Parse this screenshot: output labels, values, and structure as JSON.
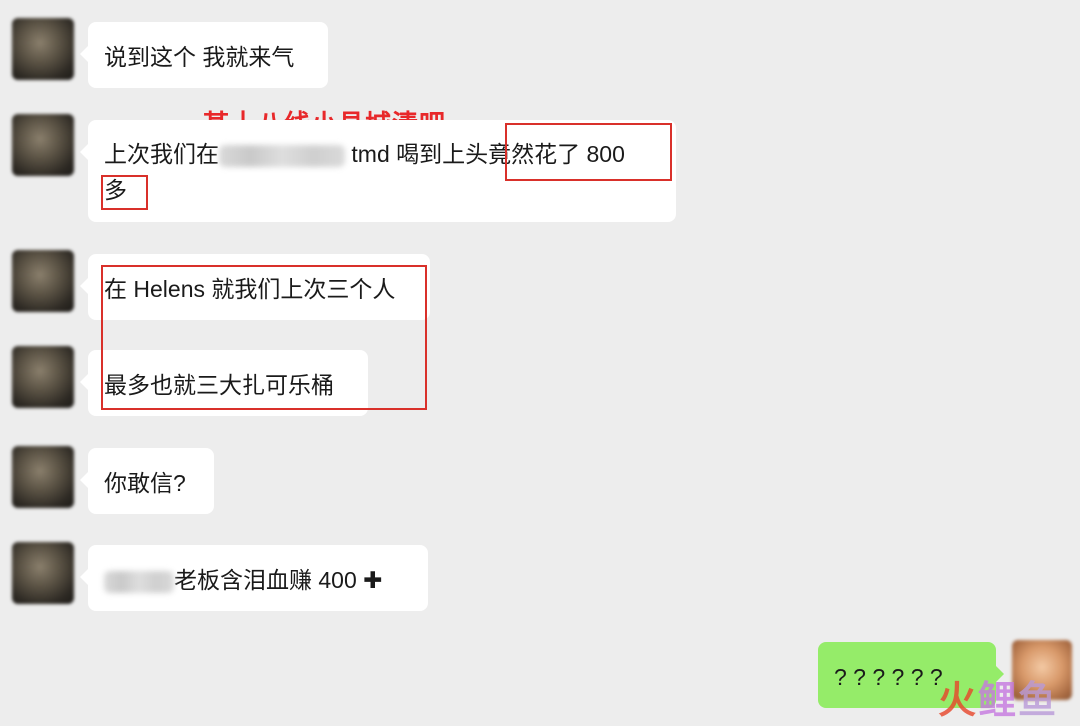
{
  "messages": [
    {
      "text": "说到这个 我就来气"
    },
    {
      "part1": "上次我们在",
      "part2": " tmd 喝到上头",
      "part3": "竟然花了 800",
      "line2": "多"
    },
    {
      "text": "在 Helens 就我们上次三个人"
    },
    {
      "text": "最多也就三大扎可乐桶"
    },
    {
      "text": "你敢信?"
    },
    {
      "text": "老板含泪血赚 400",
      "icon": "plus-icon",
      "icon_glyph": "✚"
    },
    {
      "text": "? ? ? ? ? ?"
    }
  ],
  "annotation": {
    "text": "某十八线小县城清吧",
    "color": "#e8282a"
  },
  "watermark": {
    "c1": "火",
    "c2": "鲤",
    "c3": "鱼"
  },
  "colors": {
    "background": "#ededed",
    "received_bubble": "#ffffff",
    "sent_bubble": "#95ec69",
    "highlight": "#d9302a"
  }
}
